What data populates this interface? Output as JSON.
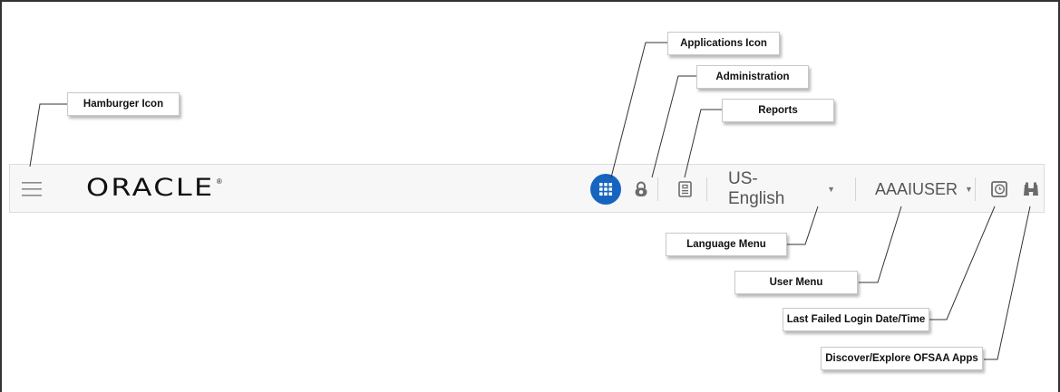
{
  "topbar": {
    "brand": "ORACLE",
    "language": "US-English",
    "user": "AAAIUSER",
    "dropdown_glyph": "▼"
  },
  "callouts": {
    "hamburger": "Hamburger Icon",
    "applications": "Applications Icon",
    "administration": "Administration",
    "reports": "Reports",
    "language": "Language Menu",
    "user": "User Menu",
    "last_failed": "Last Failed Login Date/Time",
    "discover": "Discover/Explore OFSAA Apps"
  },
  "icons": {
    "hamburger": "hamburger-menu-icon",
    "applications": "grid-apps-icon",
    "administration": "lock-icon",
    "reports": "document-icon",
    "last_failed": "clock-icon",
    "discover": "binoculars-icon"
  },
  "colors": {
    "apps_accent": "#1565c0",
    "topbar_bg": "#f7f7f7",
    "icon_gray": "#6b6b6b"
  }
}
